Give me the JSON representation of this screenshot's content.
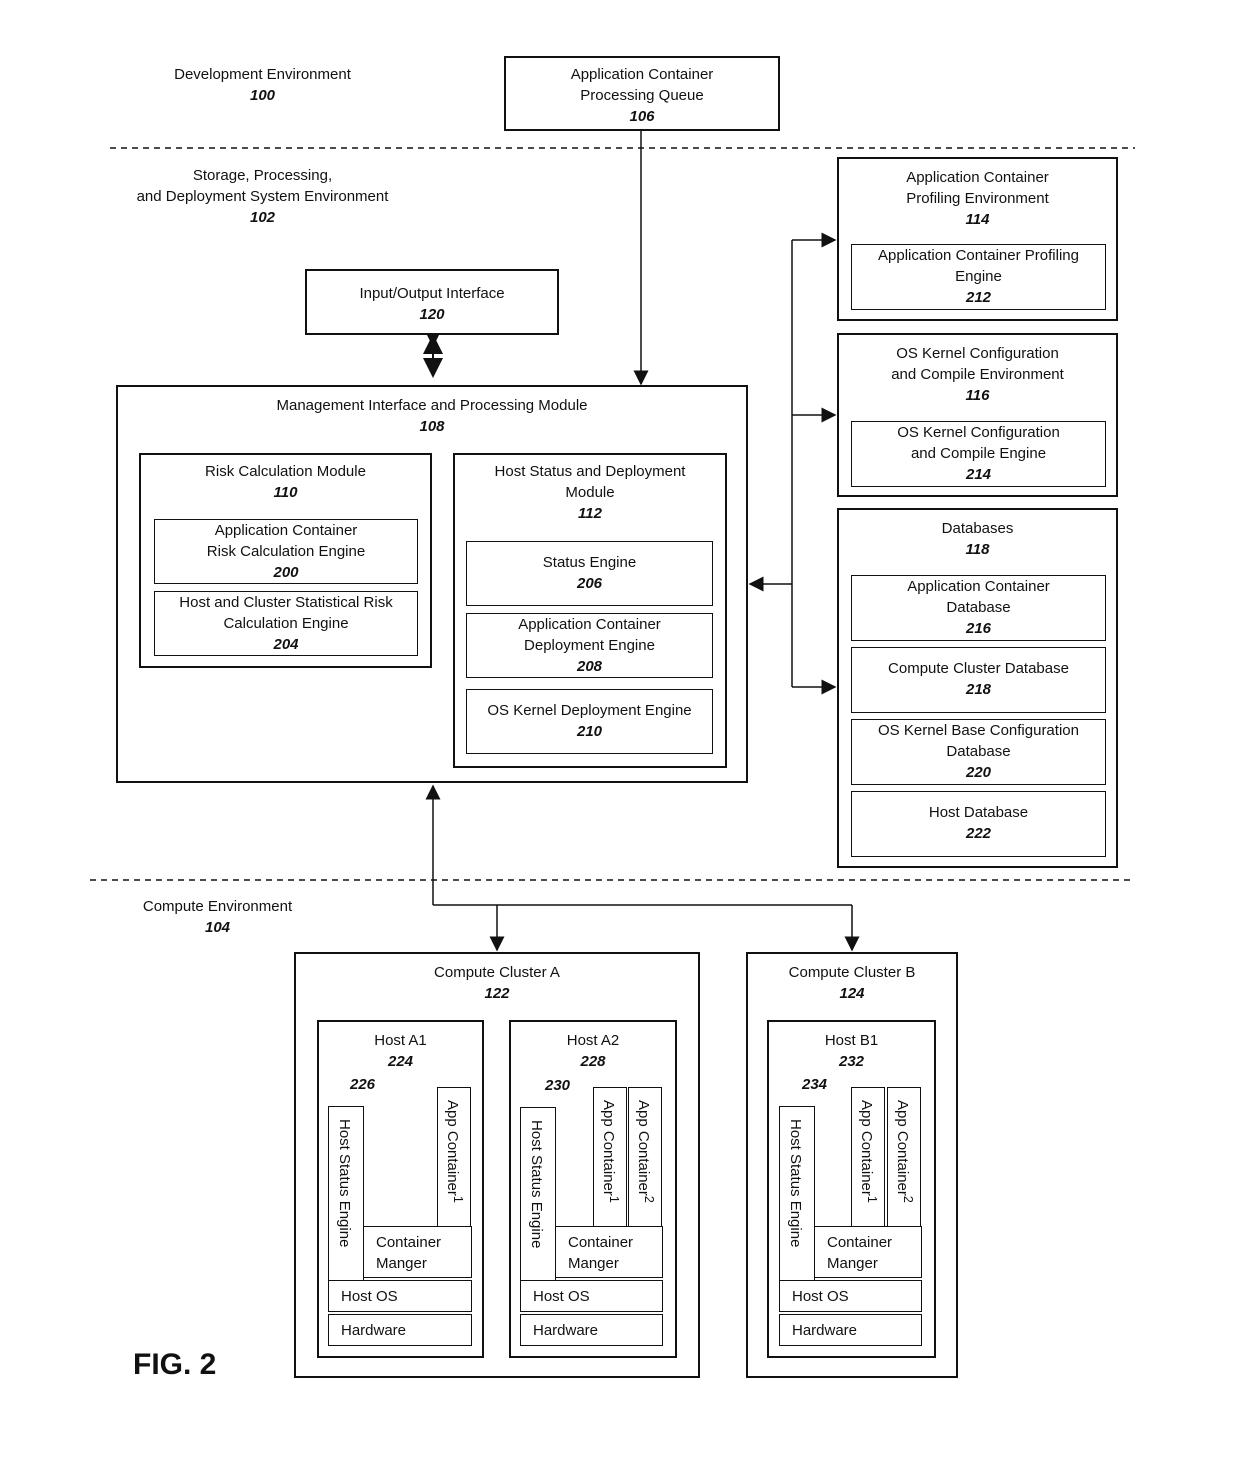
{
  "figure_label": "FIG. 2",
  "environments": {
    "development": {
      "label": "Development Environment",
      "num": "100"
    },
    "storage": {
      "label_line1": "Storage, Processing,",
      "label_line2": "and Deployment System Environment",
      "num": "102"
    },
    "compute": {
      "label": "Compute Environment",
      "num": "104"
    }
  },
  "queue": {
    "line1": "Application Container",
    "line2": "Processing Queue",
    "num": "106"
  },
  "io": {
    "label": "Input/Output Interface",
    "num": "120"
  },
  "mgmt": {
    "label": "Management Interface and Processing Module",
    "num": "108",
    "risk": {
      "label": "Risk Calculation Module",
      "num": "110",
      "engines": [
        {
          "line1": "Application Container",
          "line2": "Risk Calculation Engine",
          "num": "200"
        },
        {
          "line1": "Host and Cluster Statistical Risk",
          "line2": "Calculation Engine",
          "num": "204"
        }
      ]
    },
    "host_status": {
      "line1": "Host Status and Deployment",
      "line2": "Module",
      "num": "112",
      "engines": [
        {
          "line1": "Status Engine",
          "num": "206"
        },
        {
          "line1": "Application Container",
          "line2": "Deployment Engine",
          "num": "208"
        },
        {
          "line1": "OS Kernel Deployment Engine",
          "num": "210"
        }
      ]
    }
  },
  "profiling": {
    "line1": "Application Container",
    "line2": "Profiling Environment",
    "num": "114",
    "engine": {
      "line1": "Application Container Profiling",
      "line2": "Engine",
      "num": "212"
    }
  },
  "kernel_env": {
    "line1": "OS Kernel Configuration",
    "line2": "and Compile Environment",
    "num": "116",
    "engine": {
      "line1": "OS Kernel Configuration",
      "line2": "and Compile Engine",
      "num": "214"
    }
  },
  "databases": {
    "label": "Databases",
    "num": "118",
    "items": [
      {
        "line1": "Application Container",
        "line2": "Database",
        "num": "216"
      },
      {
        "line1": "Compute Cluster Database",
        "num": "218"
      },
      {
        "line1": "OS Kernel Base Configuration",
        "line2": "Database",
        "num": "220"
      },
      {
        "line1": "Host Database",
        "num": "222"
      }
    ]
  },
  "clusters": [
    {
      "label": "Compute Cluster A",
      "num": "122",
      "hosts": [
        {
          "label": "Host A1",
          "num": "224",
          "hse_ref": "226",
          "containers": [
            "App Container",
            "1"
          ]
        },
        {
          "label": "Host A2",
          "num": "228",
          "hse_ref": "230",
          "containers": [
            "App Container",
            "1",
            "2"
          ]
        }
      ]
    },
    {
      "label": "Compute Cluster B",
      "num": "124",
      "hosts": [
        {
          "label": "Host B1",
          "num": "232",
          "hse_ref": "234",
          "containers": [
            "App Container",
            "1",
            "2"
          ]
        }
      ]
    }
  ],
  "host_parts": {
    "hse": "Host Status Engine",
    "cm_line1": "Container",
    "cm_line2": "Manger",
    "os": "Host OS",
    "hw": "Hardware",
    "app": "App Container",
    "sup1": "1",
    "sup2": "2"
  }
}
